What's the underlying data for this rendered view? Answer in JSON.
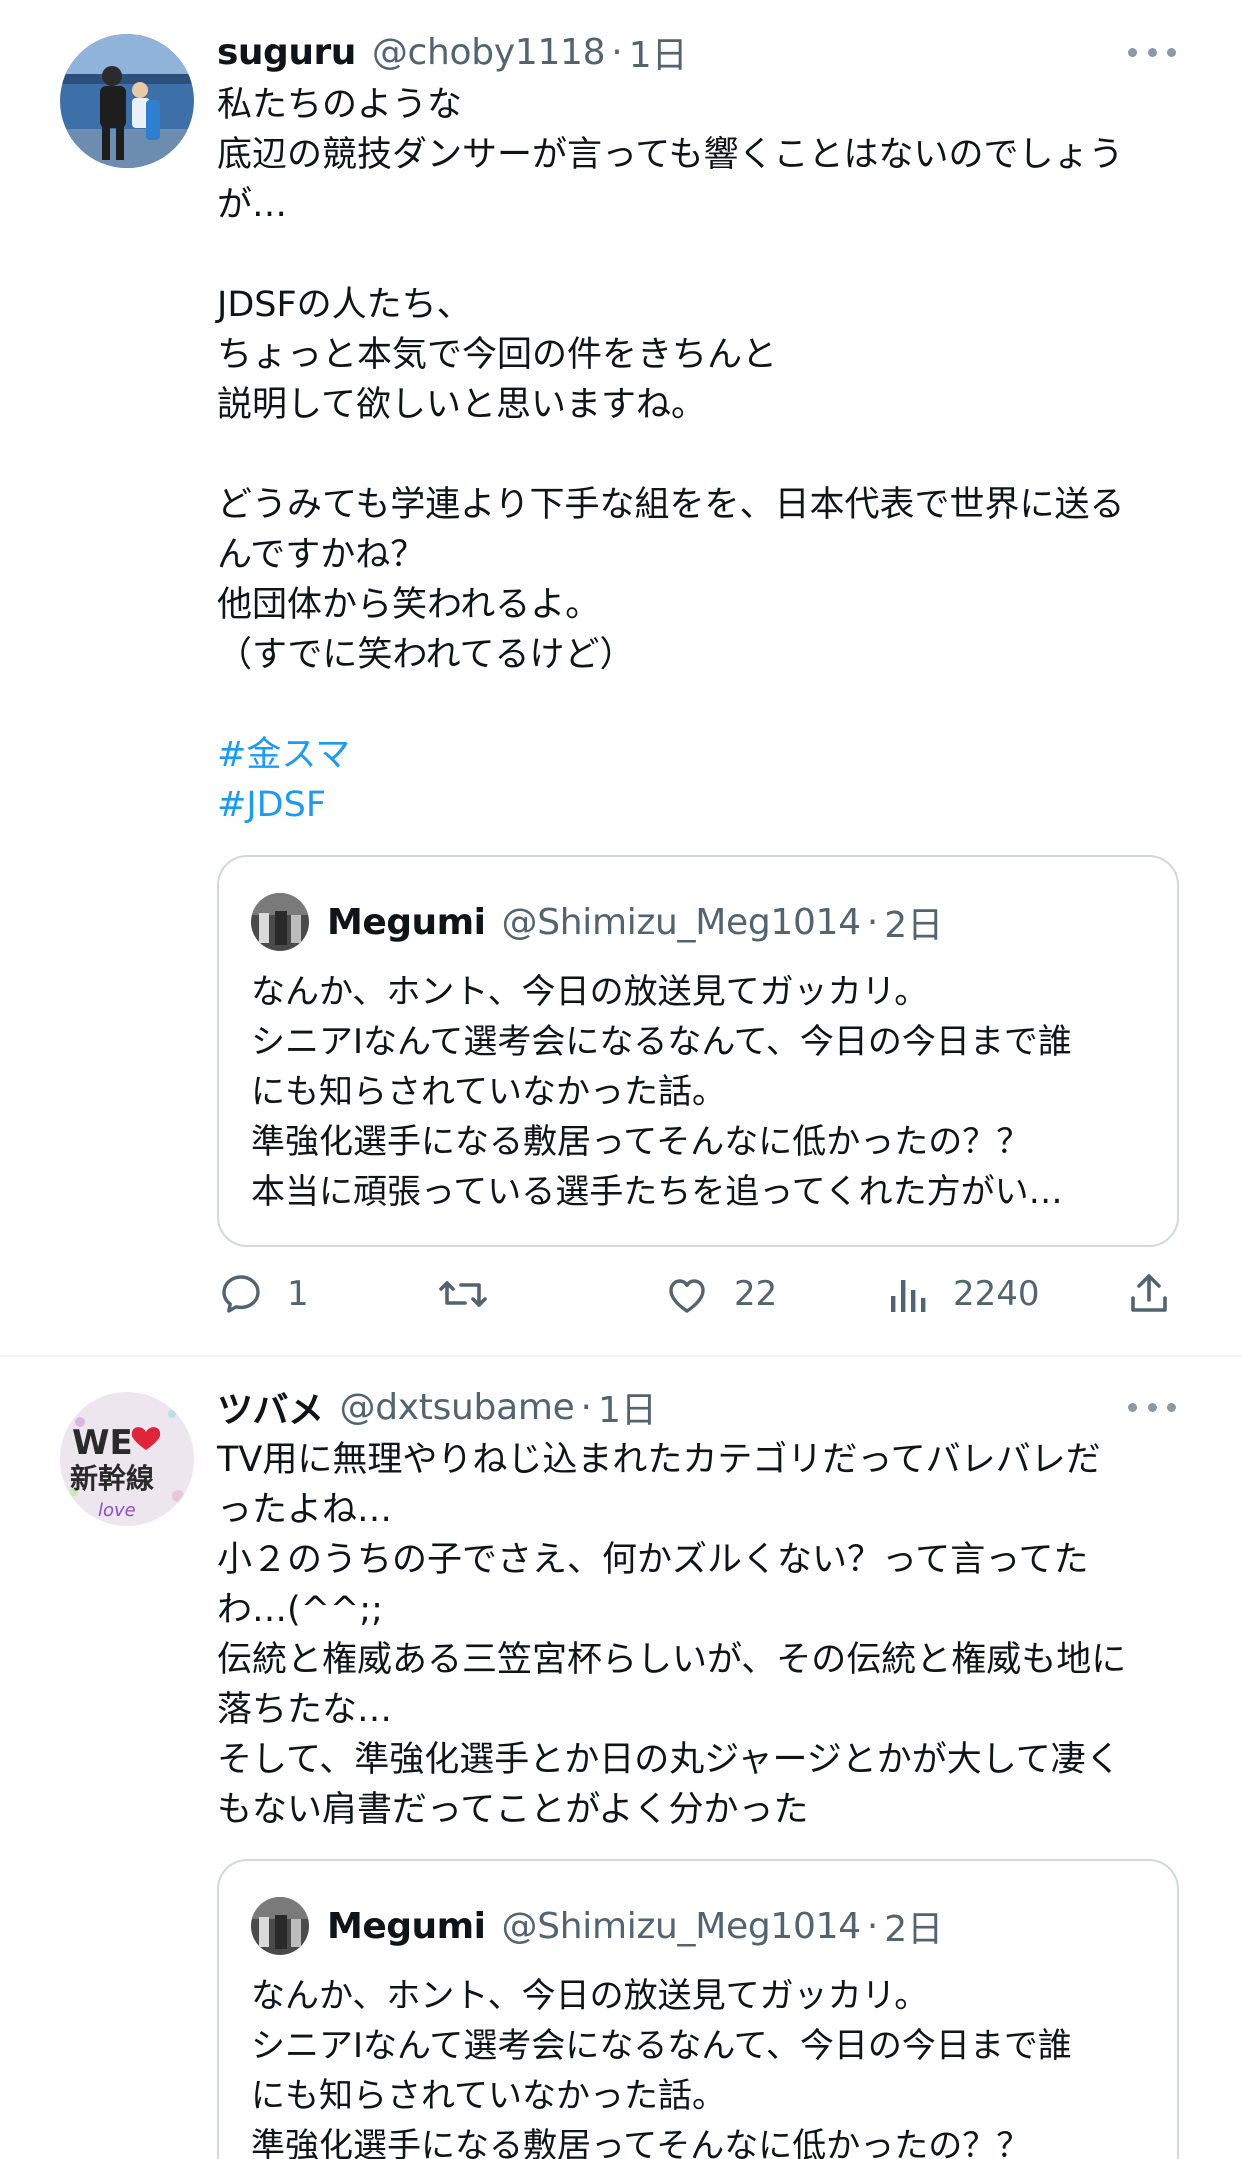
{
  "tweets": [
    {
      "name": "suguru",
      "handle": "@choby1118",
      "time": "1日",
      "lines": [
        "私たちのような",
        "底辺の競技ダンサーが言っても響くことはないのでしょう",
        "が…",
        "",
        "JDSFの人たち、",
        "ちょっと本気で今回の件をきちんと",
        "説明して欲しいと思いますね。",
        "",
        "どうみても学連より下手な組をを、日本代表で世界に送る",
        "んですかね？",
        "他団体から笑われるよ。",
        "（すでに笑われてるけど）",
        ""
      ],
      "hashtags": [
        "#金スマ",
        "#JDSF"
      ],
      "quote": {
        "name": "Megumi",
        "handle": "@Shimizu_Meg1014",
        "time": "2日",
        "lines": [
          "なんか、ホント、今日の放送見てガッカリ。",
          "シニアⅠなんて選考会になるなんて、今日の今日まで誰",
          "にも知らされていなかった話。",
          "準強化選手になる敷居ってそんなに低かったの？？",
          "本当に頑張っている選手たちを追ってくれた方がい…"
        ]
      },
      "stats": {
        "replies": "1",
        "retweets": "",
        "likes": "22",
        "views": "2240"
      }
    },
    {
      "name": "ツバメ",
      "handle": "@dxtsubame",
      "time": "1日",
      "avatar_text": {
        "line1": "WE",
        "line2": "新幹線",
        "line3": "love"
      },
      "lines": [
        "TV用に無理やりねじ込まれたカテゴリだってバレバレだ",
        "ったよね…",
        "小２のうちの子でさえ、何かズルくない？って言ってた",
        "わ…(^^;;",
        "伝統と権威ある三笠宮杯らしいが、その伝統と権威も地に",
        "落ちたな…",
        "そして、準強化選手とか日の丸ジャージとかが大して凄く",
        "もない肩書だってことがよく分かった"
      ],
      "quote": {
        "name": "Megumi",
        "handle": "@Shimizu_Meg1014",
        "time": "2日",
        "lines": [
          "なんか、ホント、今日の放送見てガッカリ。",
          "シニアⅠなんて選考会になるなんて、今日の今日まで誰",
          "にも知らされていなかった話。",
          "準強化選手になる敷居ってそんなに低かったの？？"
        ]
      }
    }
  ],
  "separator": "·",
  "colors": {
    "text": "#0f1419",
    "secondary": "#536471",
    "link": "#1d9bf0",
    "border": "#cfd9de"
  }
}
